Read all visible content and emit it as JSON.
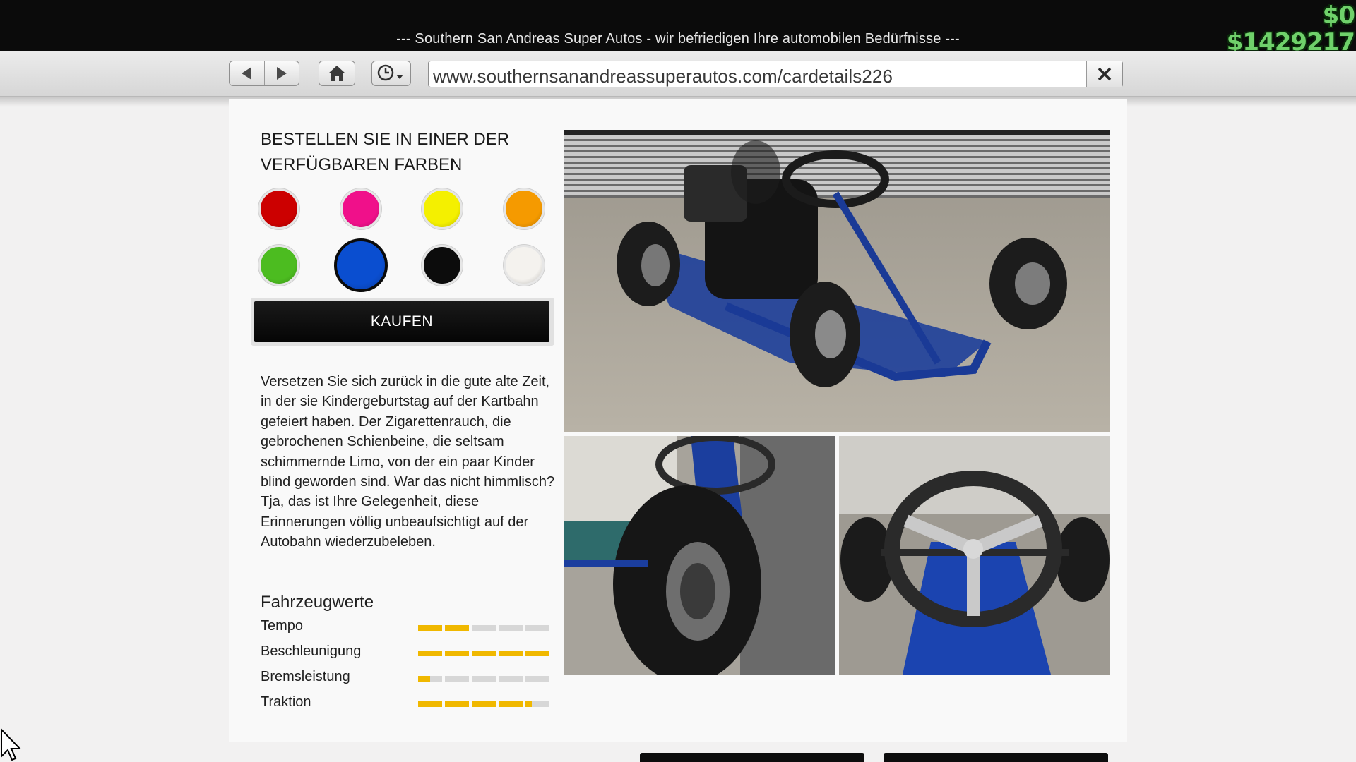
{
  "window": {
    "title": "--- Southern San Andreas Super Autos - wir befriedigen Ihre automobilen Bedürfnisse ---"
  },
  "hud": {
    "money_change": "$0",
    "money_total": "$1429217",
    "money_color": "#6fd16a"
  },
  "browser": {
    "back_icon": "back-arrow-icon",
    "forward_icon": "forward-arrow-icon",
    "home_icon": "home-icon",
    "history_icon": "history-clock-icon",
    "url": "www.southernsanandreassuperautos.com/cardetails226",
    "close_icon": "close-icon"
  },
  "order": {
    "heading": "BESTELLEN SIE IN EINER DER VERFÜGBAREN FARBEN",
    "colors": [
      {
        "name": "red",
        "hex": "#cc0000",
        "selected": false
      },
      {
        "name": "pink",
        "hex": "#f0108a",
        "selected": false
      },
      {
        "name": "yellow",
        "hex": "#f4f000",
        "selected": false
      },
      {
        "name": "orange",
        "hex": "#f59a00",
        "selected": false
      },
      {
        "name": "green",
        "hex": "#4cbc20",
        "selected": false
      },
      {
        "name": "blue",
        "hex": "#0a4ed0",
        "selected": true
      },
      {
        "name": "black",
        "hex": "#0c0c0c",
        "selected": false
      },
      {
        "name": "white",
        "hex": "#f4f2ee",
        "selected": false
      }
    ],
    "buy_label": "KAUFEN"
  },
  "description": "Versetzen Sie sich zurück in die gute alte Zeit, in der sie Kindergeburtstag auf der Kartbahn gefeiert haben. Der Zigarettenrauch, die gebrochenen Schienbeine, die seltsam schimmernde Limo, von der ein paar Kinder blind geworden sind. War das nicht himmlisch? Tja, das ist Ihre Gelegenheit, diese Erinnerungen völlig unbeaufsichtigt auf der Autobahn wiederzubeleben.",
  "stats": {
    "title": "Fahrzeugwerte",
    "bar_color": "#f0b800",
    "items": [
      {
        "label": "Tempo",
        "value": 0.4
      },
      {
        "label": "Beschleunigung",
        "value": 1.0
      },
      {
        "label": "Bremsleistung",
        "value": 0.1
      },
      {
        "label": "Traktion",
        "value": 0.85
      }
    ]
  },
  "photos": {
    "main": "go-kart-rear-three-quarter-photo",
    "side": "go-kart-side-wheel-photo",
    "front": "go-kart-steering-wheel-photo"
  }
}
